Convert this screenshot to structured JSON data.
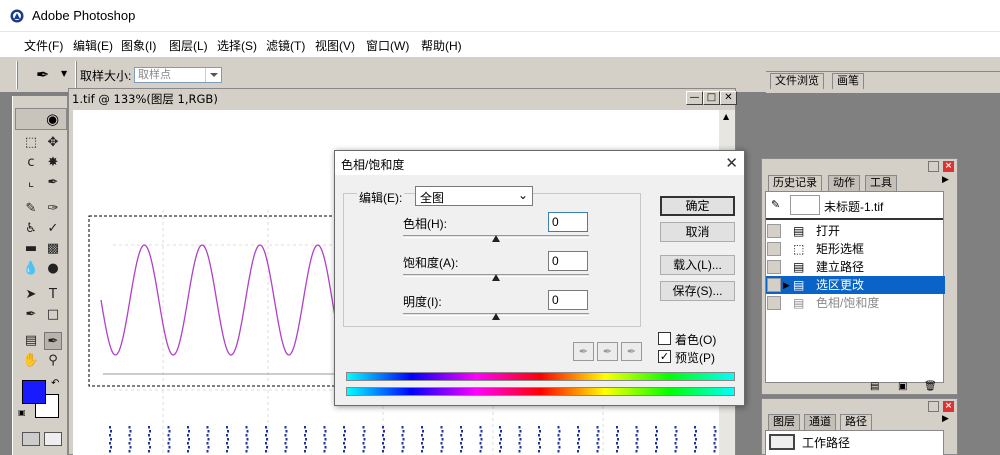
{
  "app": {
    "title": "Adobe Photoshop"
  },
  "menu": [
    "文件(F)",
    "编辑(E)",
    "图象(I)",
    "图层(L)",
    "选择(S)",
    "滤镜(T)",
    "视图(V)",
    "窗口(W)",
    "帮助(H)"
  ],
  "options": {
    "sample_size_label": "取样大小:",
    "sample_size_value": "取样点"
  },
  "palette_well": {
    "tabs": [
      "文件浏览",
      "画笔"
    ]
  },
  "image_window": {
    "title": "1.tif @ 133%(图层 1,RGB)"
  },
  "dialog": {
    "title": "色相/饱和度",
    "edit_label": "编辑(E):",
    "edit_value": "全图",
    "hue_label": "色相(H):",
    "hue_value": "0",
    "saturation_label": "饱和度(A):",
    "saturation_value": "0",
    "lightness_label": "明度(I):",
    "lightness_value": "0",
    "buttons": {
      "ok": "确定",
      "cancel": "取消",
      "load": "载入(L)...",
      "save": "保存(S)..."
    },
    "colorize_label": "着色(O)",
    "colorize_checked": false,
    "preview_label": "预览(P)",
    "preview_checked": true
  },
  "history_panel": {
    "tabs": [
      "历史记录",
      "动作",
      "工具"
    ],
    "snapshot_name": "未标题-1.tif",
    "items": [
      {
        "label": "打开",
        "state": "normal"
      },
      {
        "label": "矩形选框",
        "state": "normal"
      },
      {
        "label": "建立路径",
        "state": "normal"
      },
      {
        "label": "选区更改",
        "state": "selected"
      },
      {
        "label": "色相/饱和度",
        "state": "dimmed"
      }
    ]
  },
  "layers_panel": {
    "tabs": [
      "图层",
      "通道",
      "路径"
    ],
    "path_name": "工作路径"
  },
  "colors": {
    "foreground": "#1a1aff",
    "background": "#ffffff",
    "selection_highlight": "#0a64c8",
    "waveform": "#b040c8",
    "dots": "#2030a0"
  }
}
